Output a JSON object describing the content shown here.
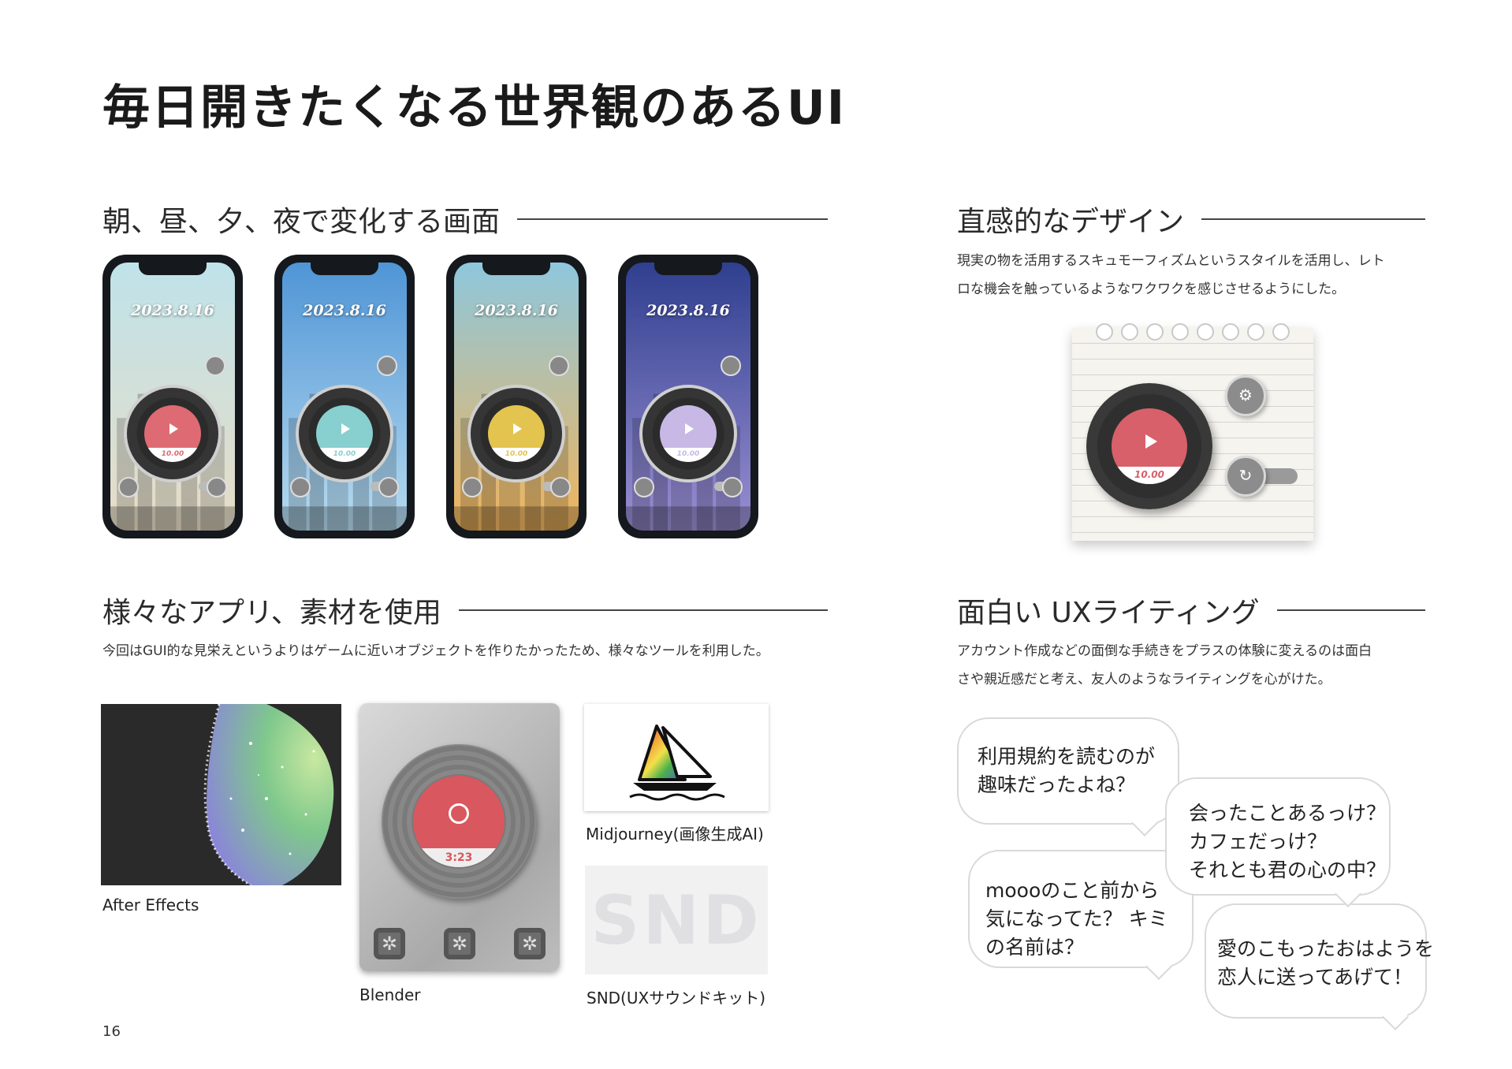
{
  "title": "毎日開きたくなる世界観のあるUI",
  "sections": {
    "time_of_day": {
      "heading": "朝、昼、夕、夜で変化する画面"
    },
    "intuitive": {
      "heading": "直感的なデザイン",
      "desc_line1": "現実の物を活用するスキュモーフィズムというスタイルを活用し、レト",
      "desc_line2": "ロな機会を触っているようなワクワクを感じさせるようにした。"
    },
    "tools": {
      "heading": "様々なアプリ、素材を使用",
      "desc": "今回はGUI的な見栄えというよりはゲームに近いオブジェクトを作りたかったため、様々なツールを利用した。"
    },
    "ux_writing": {
      "heading": "面白い UXライティング",
      "desc_line1": "アカウント作成などの面倒な手続きをプラスの体験に変えるのは面白",
      "desc_line2": "さや親近感だと考え、友人のようなライティングを心がけた。"
    }
  },
  "phones": [
    {
      "date": "2023.8.16",
      "time": "10.00",
      "sky_top": "#bfe3ea",
      "sky_bottom": "#e7dcc6",
      "label_color": "#de6b73"
    },
    {
      "date": "2023.8.16",
      "time": "10.00",
      "sky_top": "#4f95d6",
      "sky_bottom": "#b7dbef",
      "label_color": "#88cfcf"
    },
    {
      "date": "2023.8.16",
      "time": "10.00",
      "sky_top": "#8ec7dd",
      "sky_bottom": "#f0b45c",
      "label_color": "#e3c44e"
    },
    {
      "date": "2023.8.16",
      "time": "10.00",
      "sky_top": "#2f3f8f",
      "sky_bottom": "#9a8fd2",
      "label_color": "#c7b8e6"
    }
  ],
  "notebook": {
    "time": "10.00",
    "settings_icon": "gear-icon",
    "repeat_icon": "repeat-icon"
  },
  "tools": {
    "after_effects": "After Effects",
    "blender": "Blender",
    "blender_time": "3:23",
    "midjourney": "Midjourney(画像生成AI)",
    "snd": "SND(UXサウンドキット)",
    "snd_logo": "SND"
  },
  "bubbles": [
    {
      "line1": "利用規約を読むのが",
      "line2": "趣味だったよね？"
    },
    {
      "line1": "会ったことあるっけ？",
      "line2": "カフェだっけ？",
      "line3": "それとも君の心の中？"
    },
    {
      "line1": "moooのこと前から",
      "line2": "気になってた？ キミ",
      "line3": "の名前は？"
    },
    {
      "line1": "愛のこもったおはようを",
      "line2": "恋人に送ってあげて！"
    }
  ],
  "page_number": "16"
}
